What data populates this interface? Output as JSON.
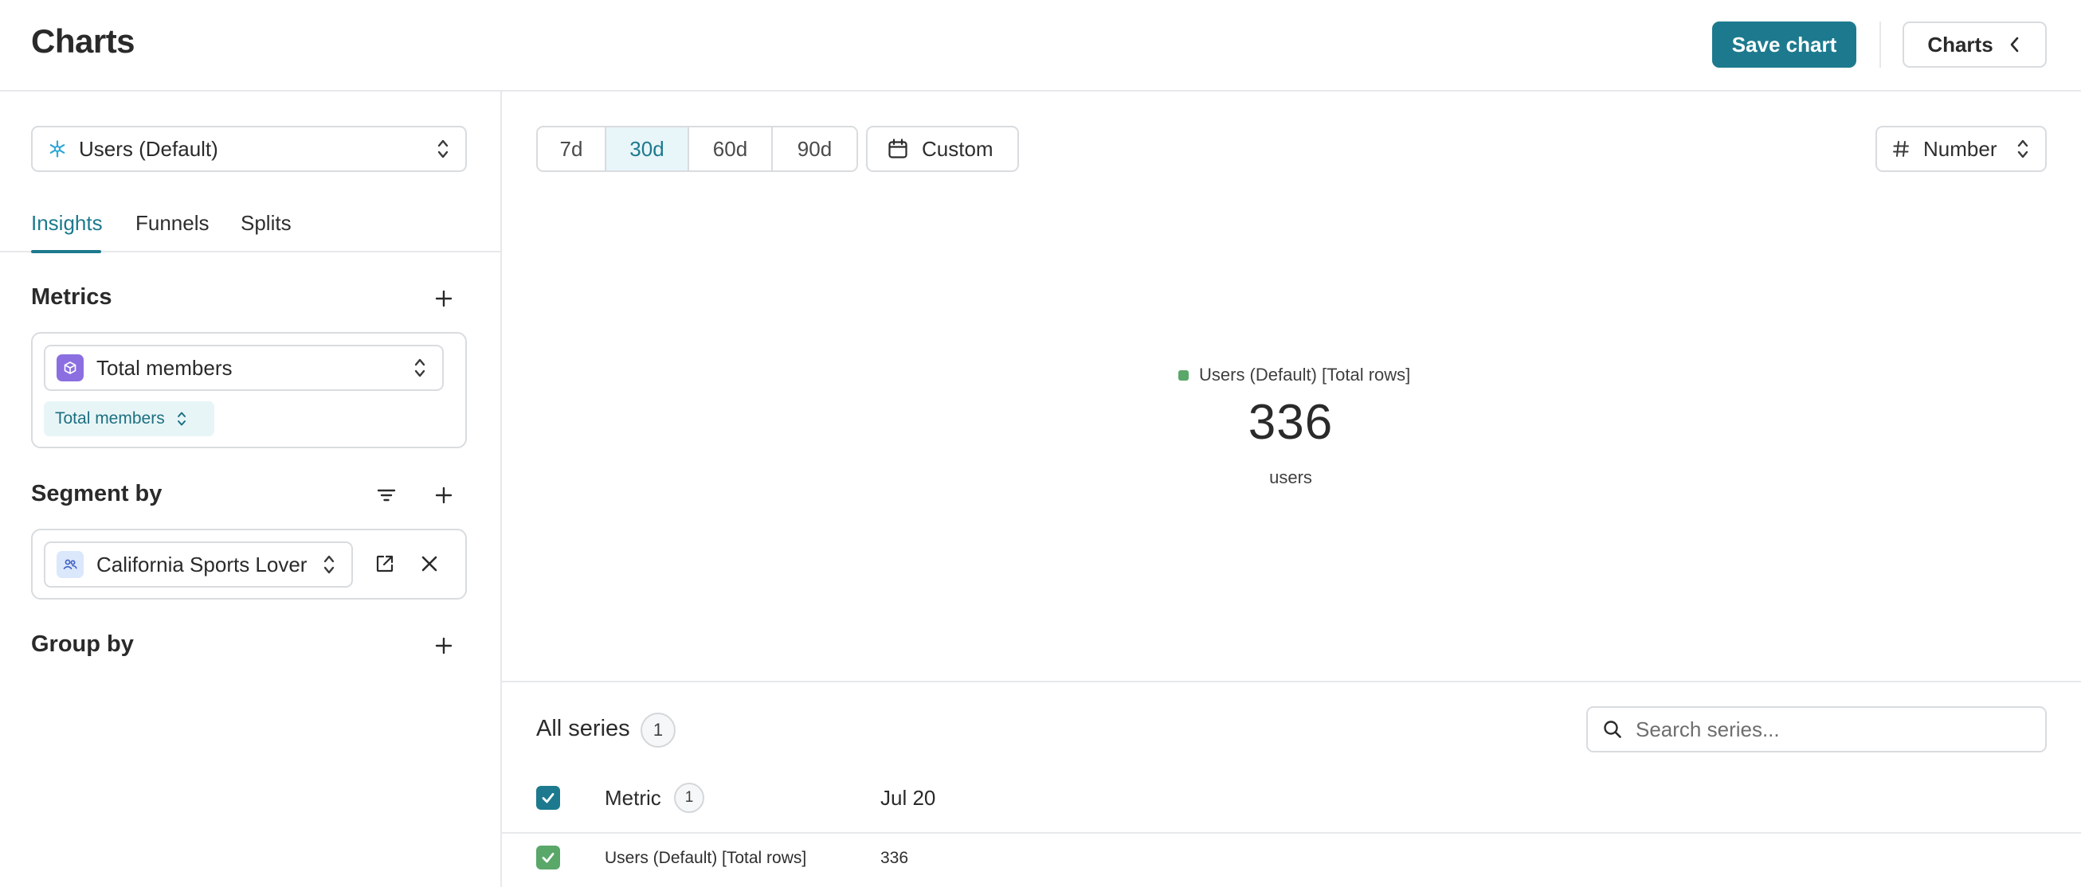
{
  "header": {
    "title": "Charts",
    "save_label": "Save chart",
    "charts_label": "Charts"
  },
  "sidebar": {
    "source_select": {
      "label": "Users (Default)",
      "icon": "snowflake-icon"
    },
    "tabs": [
      {
        "label": "Insights",
        "active": true
      },
      {
        "label": "Funnels",
        "active": false
      },
      {
        "label": "Splits",
        "active": false
      }
    ],
    "metrics": {
      "title": "Metrics",
      "select_label": "Total members",
      "chip_label": "Total members"
    },
    "segment_by": {
      "title": "Segment by",
      "select_label": "California Sports Lovers"
    },
    "group_by": {
      "title": "Group by"
    }
  },
  "main": {
    "ranges": [
      {
        "label": "7d",
        "active": false
      },
      {
        "label": "30d",
        "active": true
      },
      {
        "label": "60d",
        "active": false
      },
      {
        "label": "90d",
        "active": false
      }
    ],
    "custom_label": "Custom",
    "chart_type_label": "Number",
    "legend_label": "Users (Default) [Total rows]",
    "big_number": "336",
    "unit": "users",
    "series": {
      "title": "All series",
      "count": "1",
      "search_placeholder": "Search series...",
      "columns": {
        "metric": "Metric",
        "metric_count": "1",
        "date": "Jul 20"
      },
      "rows": [
        {
          "name": "Users (Default) [Total rows]",
          "value": "336"
        }
      ]
    }
  },
  "colors": {
    "accent": "#1d7a8e",
    "series_green": "#5aa76a",
    "metric_badge": "#8b6fe0",
    "segment_badge": "#dbe7fb"
  }
}
